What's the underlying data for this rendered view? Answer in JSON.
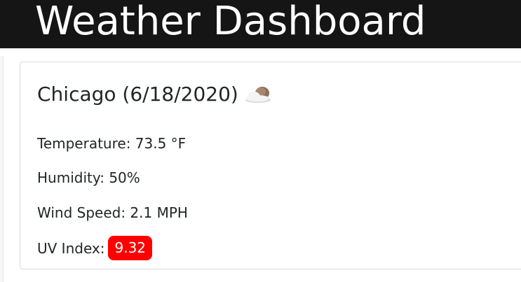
{
  "header": {
    "title": "Weather Dashboard"
  },
  "current": {
    "city_title": "Chicago (6/18/2020)",
    "weather_icon": "few-clouds-icon",
    "temperature_label": "Temperature:",
    "temperature_value": "73.5 °F",
    "humidity_label": "Humidity:",
    "humidity_value": "50%",
    "wind_label": "Wind Speed:",
    "wind_value": "2.1 MPH",
    "uv_label": "UV Index:",
    "uv_value": "9.32",
    "uv_color": "#ff0000"
  }
}
